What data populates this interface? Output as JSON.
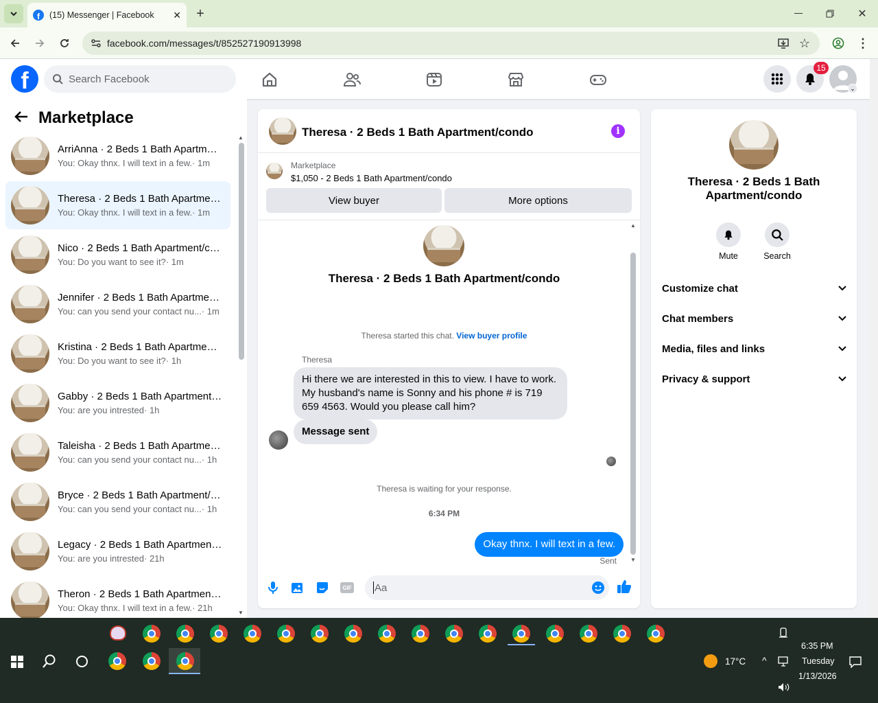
{
  "browser": {
    "tab_title": "(15) Messenger | Facebook",
    "url": "facebook.com/messages/t/852527190913998"
  },
  "header": {
    "search_placeholder": "Search Facebook",
    "notif_count": "15"
  },
  "sidebar": {
    "title": "Marketplace",
    "conversations": [
      {
        "name": "ArriAnna · 2 Beds 1 Bath Apartment/condo",
        "preview": "You: Okay thnx. I will text in a few.",
        "time": "· 1m",
        "active": false
      },
      {
        "name": "Theresa · 2 Beds 1 Bath Apartment/condo",
        "preview": "You: Okay thnx. I will text in a few.",
        "time": "· 1m",
        "active": true
      },
      {
        "name": "Nico · 2 Beds 1 Bath Apartment/condo",
        "preview": "You: Do you want to see it?",
        "time": "· 1m",
        "active": false
      },
      {
        "name": "Jennifer · 2 Beds 1 Bath Apartment/condo",
        "preview": "You: can you send your contact nu...",
        "time": "· 1m",
        "active": false
      },
      {
        "name": "Kristina · 2 Beds 1 Bath Apartment/condo",
        "preview": "You: Do you want to see it?",
        "time": "· 1h",
        "active": false
      },
      {
        "name": "Gabby · 2 Beds 1 Bath Apartment/condo",
        "preview": "You: are you intrested",
        "time": "· 1h",
        "active": false
      },
      {
        "name": "Taleisha · 2 Beds 1 Bath Apartment/condo",
        "preview": "You: can you send your contact nu...",
        "time": "· 1h",
        "active": false
      },
      {
        "name": "Bryce · 2 Beds 1 Bath Apartment/condo",
        "preview": "You: can you send your contact nu...",
        "time": "· 1h",
        "active": false
      },
      {
        "name": "Legacy · 2 Beds 1 Bath Apartment/condo",
        "preview": "You: are you intrested",
        "time": "· 21h",
        "active": false
      },
      {
        "name": "Theron · 2 Beds 1 Bath Apartment/condo",
        "preview": "You: Okay thnx. I will text in a few.",
        "time": "· 21h",
        "active": false
      }
    ]
  },
  "chat": {
    "title": "Theresa · 2 Beds 1 Bath Apartment/condo",
    "marketplace_label": "Marketplace",
    "listing": "$1,050 - 2 Beds 1 Bath Apartment/condo",
    "view_buyer": "View buyer",
    "more_options": "More options",
    "intro_title": "Theresa · 2 Beds 1 Bath Apartment/condo",
    "started_text": "Theresa started this chat.",
    "buyer_profile_link": "View buyer profile",
    "sender_name": "Theresa",
    "incoming_message": "Hi there we are interested in this to view.  I have to work. My husband's name is Sonny and his phone # is 719 659 4563.  Would you please call him?",
    "incoming_message_2": "Message sent",
    "waiting_text": "Theresa is waiting for your response.",
    "timestamp": "6:34 PM",
    "outgoing_message": "Okay thnx. I will text in a few.",
    "sent_status": "Sent",
    "input_placeholder": "Aa"
  },
  "details": {
    "name": "Theresa · 2 Beds 1 Bath Apartment/condo",
    "mute": "Mute",
    "search": "Search",
    "sections": [
      "Customize chat",
      "Chat members",
      "Media, files and links",
      "Privacy & support"
    ]
  },
  "taskbar": {
    "weather": "17°C",
    "time": "6:35 PM",
    "day": "Tuesday",
    "date": "1/13/2026"
  },
  "colors": {
    "fb_blue": "#0866ff",
    "messenger_blue": "#0084ff",
    "active_row": "#ebf5ff",
    "badge_red": "#e41e3f",
    "info_purple": "#a033ff"
  }
}
